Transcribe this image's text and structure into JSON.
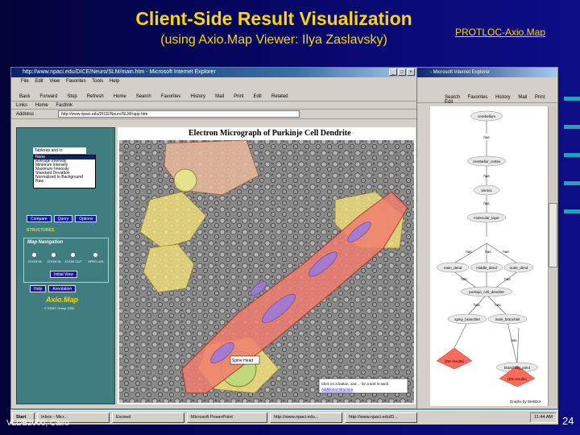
{
  "slide": {
    "title": "Client-Side Result Visualization",
    "subtitle": "(using Axio.Map Viewer: Ilya Zaslavsky)",
    "link": "PROTLOC-Axio.Map",
    "footer_left": "VLDB2000, Cairo",
    "page_number": "24",
    "accent_color": "#ffd700"
  },
  "browser": {
    "title": "http://www.npaci.edu/DICE/Neuro/SLM/main.htm - Microsoft Internet Explorer",
    "menu": [
      "File",
      "Edit",
      "View",
      "Favorites",
      "Tools",
      "Help"
    ],
    "toolbar": [
      "Back",
      "Forward",
      "Stop",
      "Refresh",
      "Home",
      "Search",
      "Favorites",
      "History",
      "Mail",
      "Print",
      "Edit",
      "Related"
    ],
    "links": [
      "Links",
      "Home",
      "Fastlink"
    ],
    "address_label": "Address",
    "address": "http://www.npaci.edu/DICE/Neuro/SLM/rapp.htm"
  },
  "browser2": {
    "title": "- Microsoft Internet Explorer",
    "toolbar": "Search Favorites History Mail Print Edit"
  },
  "panel": {
    "dropdown": "Tablerep and In",
    "list": [
      "None",
      "Average Intensity",
      "Minimum Intensity",
      "Maximum Intensity",
      "Standard Deviation",
      "Normalized to Background",
      "Raw"
    ],
    "buttons": [
      "Compare",
      "Query",
      "Options"
    ],
    "structures": "STRUCTURES",
    "map_nav": {
      "title": "Map Navigation",
      "options": [
        "ZOOM IN",
        "ZOOM IN",
        "ZOOM OUT",
        "OPEN URL"
      ],
      "initial_view": "Initial View"
    },
    "help": "Help",
    "annotation": "Annotation",
    "logo": "Axio.Map",
    "logo_sub": "© SDSC Group 2000"
  },
  "viewer": {
    "title": "Electron Micrograph of Purkinje Cell Dendrite",
    "label_spine": "Spine Head",
    "note": "Click on a button, and ... for a sort in each",
    "note2": "Additional Structure"
  },
  "graph": {
    "nodes": [
      "cerebellum",
      "has",
      "cerebellar_cortex",
      "has",
      "vermis",
      "has",
      "molecular_layer",
      "has",
      "has",
      "has",
      "main_dend",
      "middle_dend",
      "outer_dend",
      "has",
      "has",
      "purkinje_cell_dendrite",
      "has",
      "has",
      "spiny_branchlet",
      "main_branchlet",
      "has",
      "[DS results]",
      "branching_point",
      "[DS results]"
    ],
    "credit": "Graphs by WebDot"
  },
  "taskbar": {
    "start": "Start",
    "items": [
      "Inbox - Micr...",
      "Exceed",
      "Microsoft PowerPoint",
      "http://www.npaci.edu...",
      "http://www.npaci.edu/D..."
    ],
    "clock": "11:44 AM"
  }
}
